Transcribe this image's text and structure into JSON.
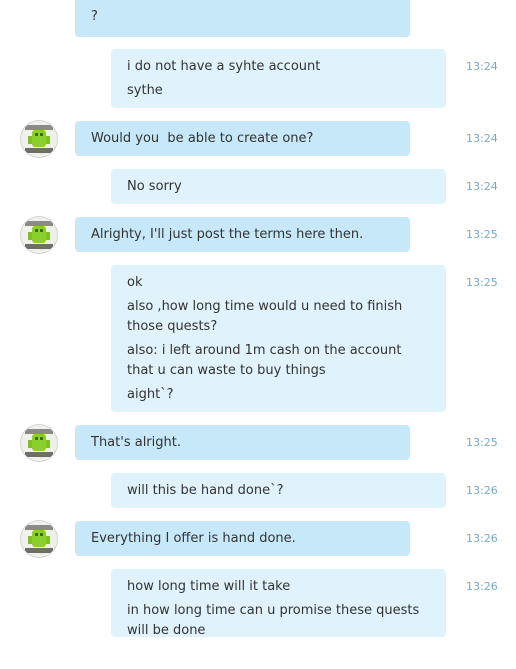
{
  "messages": [
    {
      "sender": "other",
      "lines": [
        "?"
      ],
      "time": ""
    },
    {
      "sender": "self",
      "lines": [
        "i do not have a syhte account",
        "sythe"
      ],
      "time": "13:24"
    },
    {
      "sender": "other",
      "lines": [
        "Would you  be able to create one?"
      ],
      "time": "13:24"
    },
    {
      "sender": "self",
      "lines": [
        "No sorry"
      ],
      "time": "13:24"
    },
    {
      "sender": "other",
      "lines": [
        "Alrighty, I'll just post the terms here then."
      ],
      "time": "13:25"
    },
    {
      "sender": "self",
      "lines": [
        "ok",
        "also ,how long time would u need to finish those quests?",
        "also: i left around 1m cash on the account that u can waste to buy things",
        "aight`?"
      ],
      "time": "13:25"
    },
    {
      "sender": "other",
      "lines": [
        "That's alright."
      ],
      "time": "13:25"
    },
    {
      "sender": "self",
      "lines": [
        "will this be hand done`?"
      ],
      "time": "13:26"
    },
    {
      "sender": "other",
      "lines": [
        "Everything I offer is hand done."
      ],
      "time": "13:26"
    },
    {
      "sender": "self",
      "lines": [
        "how long time will it take",
        "in how long time can u promise these quests will be done"
      ],
      "time": "13:26"
    }
  ],
  "colors": {
    "other_bubble": "#c7e8f9",
    "self_bubble": "#e0f3fc",
    "timestamp": "#7aa9bd"
  },
  "icons": {
    "avatar": "green-figure-avatar-icon"
  }
}
